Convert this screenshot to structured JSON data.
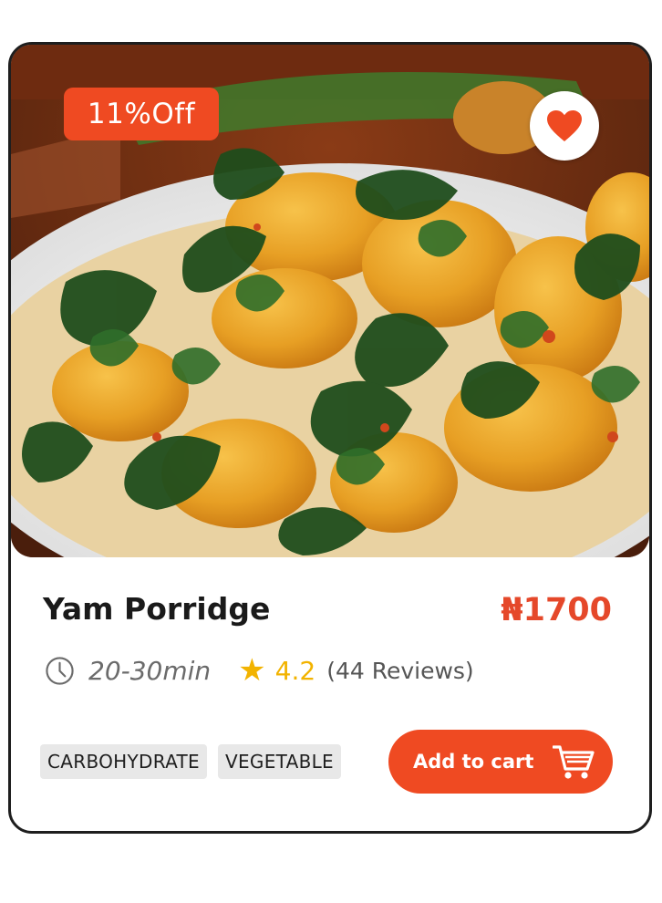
{
  "product": {
    "discount_label": "11%Off",
    "name": "Yam Porridge",
    "price": "₦1700",
    "prep_time": "20-30min",
    "rating": "4.2",
    "reviews": "(44 Reviews)",
    "tags": [
      "CARBOHYDRATE",
      "VEGETABLE"
    ],
    "favorited": true
  },
  "actions": {
    "add_to_cart_label": "Add to cart"
  },
  "icons": {
    "favorite": "heart-icon",
    "time": "clock-icon",
    "rating": "star-icon",
    "cart": "shopping-cart-icon"
  },
  "colors": {
    "accent": "#ef4a22",
    "price": "#e5482a",
    "star": "#f2b300",
    "tag_bg": "#e8e8e8",
    "card_border": "#1e1e1e"
  }
}
